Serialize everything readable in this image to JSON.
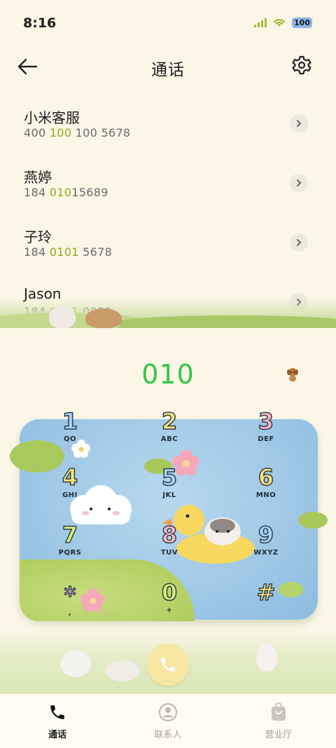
{
  "status_bar": {
    "time": "8:16",
    "battery": "100"
  },
  "header": {
    "title": "通话"
  },
  "contacts": [
    {
      "name": "小米客服",
      "number_parts": [
        "400 ",
        "100",
        " 100",
        " 5678"
      ]
    },
    {
      "name": "燕婷",
      "number_parts": [
        "184 ",
        "010",
        "15689",
        ""
      ]
    },
    {
      "name": "子玲",
      "number_parts": [
        "184 ",
        "0101",
        " 5678",
        ""
      ]
    },
    {
      "name": "Jason",
      "number_parts": [
        "184 ",
        "0101",
        " 0029",
        ""
      ]
    }
  ],
  "dial_input": "010",
  "keypad": [
    {
      "digit": "1",
      "letters": "QO",
      "color": "#a9d4ff"
    },
    {
      "digit": "2",
      "letters": "ABC",
      "color": "#ffe27a"
    },
    {
      "digit": "3",
      "letters": "DEF",
      "color": "#ffb6c8"
    },
    {
      "digit": "4",
      "letters": "GHI",
      "color": "#ffe27a"
    },
    {
      "digit": "5",
      "letters": "JKL",
      "color": "#a9d4ff"
    },
    {
      "digit": "6",
      "letters": "MNO",
      "color": "#ffe27a"
    },
    {
      "digit": "7",
      "letters": "PQRS",
      "color": "#d9f07a"
    },
    {
      "digit": "8",
      "letters": "TUV",
      "color": "#ffb6c8"
    },
    {
      "digit": "9",
      "letters": "WXYZ",
      "color": "#a9d4ff"
    },
    {
      "digit": "*",
      "letters": ",",
      "color": "#ffb6c8"
    },
    {
      "digit": "0",
      "letters": "+",
      "color": "#d9f07a"
    },
    {
      "digit": "#",
      "letters": "",
      "color": "#ffe27a"
    }
  ],
  "bottom_nav": [
    {
      "label": "通话",
      "icon": "phone-icon",
      "active": true
    },
    {
      "label": "联系人",
      "icon": "person-icon",
      "active": false
    },
    {
      "label": "营业厅",
      "icon": "shopping-bag-icon",
      "active": false
    }
  ],
  "colors": {
    "accent_green": "#2fc743",
    "highlight": "#8cab15",
    "background": "#fbf6e6"
  }
}
